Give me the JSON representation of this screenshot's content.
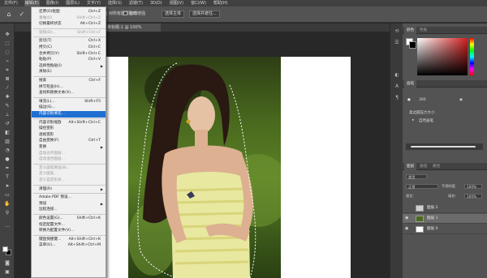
{
  "menubar": {
    "items": [
      "文件(F)",
      "编辑(E)",
      "图像(I)",
      "图层(L)",
      "文字(Y)",
      "选择(S)",
      "滤镜(T)",
      "3D(D)",
      "视图(V)",
      "窗口(W)",
      "帮助(H)"
    ]
  },
  "options": {
    "sample_all_label": "对所有图层取样",
    "auto_enhance_label": "自动增强",
    "select_subject_label": "选择主体",
    "select_mask_label": "选择并遮住..."
  },
  "document_tab": {
    "label": "未标题-1 @ 100%"
  },
  "edit_menu": {
    "items": [
      {
        "label": "还原(O)抠图",
        "shortcut": "Ctrl+Z",
        "state": "enabled"
      },
      {
        "label": "重做(O)",
        "shortcut": "Shift+Ctrl+Z",
        "state": "disabled"
      },
      {
        "label": "切换最终状态",
        "shortcut": "Alt+Ctrl+Z",
        "state": "enabled"
      },
      {
        "sep": true
      },
      {
        "label": "渐隐(D)...",
        "shortcut": "Shift+Ctrl+F",
        "state": "disabled"
      },
      {
        "sep": true
      },
      {
        "label": "剪切(T)",
        "shortcut": "Ctrl+X",
        "state": "enabled"
      },
      {
        "label": "拷贝(C)",
        "shortcut": "Ctrl+C",
        "state": "enabled"
      },
      {
        "label": "合并拷贝(Y)",
        "shortcut": "Shift+Ctrl+C",
        "state": "enabled"
      },
      {
        "label": "粘贴(P)",
        "shortcut": "Ctrl+V",
        "state": "enabled"
      },
      {
        "label": "选择性粘贴(I)",
        "shortcut": "",
        "state": "sub"
      },
      {
        "label": "清除(E)",
        "shortcut": "",
        "state": "enabled"
      },
      {
        "sep": true
      },
      {
        "label": "搜索",
        "shortcut": "Ctrl+F",
        "state": "enabled"
      },
      {
        "label": "拼写检查(H)...",
        "shortcut": "",
        "state": "enabled"
      },
      {
        "label": "查找和替换文本(X)...",
        "shortcut": "",
        "state": "enabled"
      },
      {
        "sep": true
      },
      {
        "label": "填充(L)...",
        "shortcut": "Shift+F5",
        "state": "enabled"
      },
      {
        "label": "描边(S)...",
        "shortcut": "",
        "state": "enabled"
      },
      {
        "label": "内容识别填充...",
        "shortcut": "",
        "state": "highlighted"
      },
      {
        "sep": true
      },
      {
        "label": "内容识别缩放",
        "shortcut": "Alt+Shift+Ctrl+C",
        "state": "enabled"
      },
      {
        "label": "操控变形",
        "shortcut": "",
        "state": "enabled"
      },
      {
        "label": "透视变形",
        "shortcut": "",
        "state": "enabled"
      },
      {
        "label": "自由变换(F)",
        "shortcut": "Ctrl+T",
        "state": "enabled"
      },
      {
        "label": "变换",
        "shortcut": "",
        "state": "sub"
      },
      {
        "label": "自动对齐图层...",
        "shortcut": "",
        "state": "disabled"
      },
      {
        "label": "自动混合图层...",
        "shortcut": "",
        "state": "disabled"
      },
      {
        "sep": true
      },
      {
        "label": "定义画笔预设(B)...",
        "shortcut": "",
        "state": "disabled"
      },
      {
        "label": "定义图案...",
        "shortcut": "",
        "state": "disabled"
      },
      {
        "label": "定义自定形状...",
        "shortcut": "",
        "state": "disabled"
      },
      {
        "sep": true
      },
      {
        "label": "清理(R)",
        "shortcut": "",
        "state": "sub"
      },
      {
        "sep": true
      },
      {
        "label": "Adobe PDF 预设...",
        "shortcut": "",
        "state": "enabled"
      },
      {
        "label": "预设",
        "shortcut": "",
        "state": "sub"
      },
      {
        "label": "远程连接...",
        "shortcut": "",
        "state": "enabled"
      },
      {
        "sep": true
      },
      {
        "label": "颜色设置(G)...",
        "shortcut": "Shift+Ctrl+K",
        "state": "enabled"
      },
      {
        "label": "指定配置文件...",
        "shortcut": "",
        "state": "enabled"
      },
      {
        "label": "转换为配置文件(V)...",
        "shortcut": "",
        "state": "enabled"
      },
      {
        "sep": true
      },
      {
        "label": "键盘快捷键...",
        "shortcut": "Alt+Shift+Ctrl+K",
        "state": "enabled"
      },
      {
        "label": "菜单(U)...",
        "shortcut": "Alt+Shift+Ctrl+M",
        "state": "enabled"
      }
    ]
  },
  "panels": {
    "color_tabs": [
      "颜色",
      "色板"
    ],
    "brush_tabs": [
      "画笔"
    ],
    "brush_size_label": "300",
    "brush_preset_label": "柔边圆压力大小",
    "brush_item_label": "自然画笔",
    "layers_tabs": [
      "图层",
      "通道",
      "路径"
    ],
    "kind_label": "类型",
    "blend_mode": "正常",
    "opacity_label": "不透明度:",
    "opacity_value": "100%",
    "lock_label": "锁定:",
    "fill_label": "填充:",
    "fill_value": "100%",
    "layers": [
      {
        "name": "图层 2",
        "selected": false,
        "visible": false
      },
      {
        "name": "图层 1",
        "selected": true,
        "visible": true
      },
      {
        "name": "图层 0",
        "selected": false,
        "visible": true
      }
    ]
  },
  "colors": {
    "menu_highlight": "#1f6fd1",
    "photo_bg": "#4a6a1e"
  }
}
